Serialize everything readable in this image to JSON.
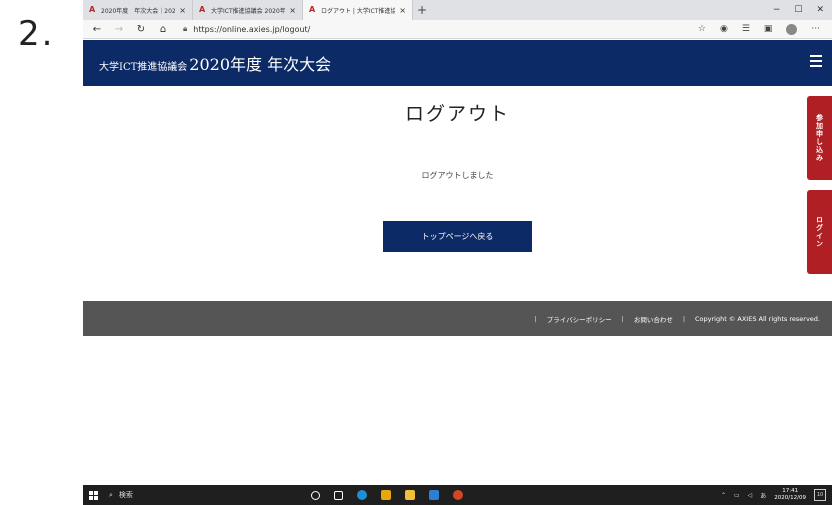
{
  "step_label": "2.",
  "browser": {
    "tabs": [
      {
        "title": "2020年度　年次大会｜2020年 ...",
        "active": false
      },
      {
        "title": "大学ICT推進協議会 2020年度 年...",
        "active": false
      },
      {
        "title": "ログアウト | 大学ICT推進協議会 20...",
        "active": true
      }
    ],
    "new_tab": "+",
    "close_glyph": "×",
    "url": "https://online.axies.jp/logout/",
    "window_controls": {
      "minimize": "−",
      "maximize": "☐",
      "close": "✕"
    },
    "more_glyph": "···"
  },
  "site": {
    "title_prefix": "大学ICT推進協議会",
    "title_main": "2020年度 年次大会",
    "page_title": "ログアウト",
    "message": "ログアウトしました",
    "top_button": "トップページへ戻る",
    "side_tabs": {
      "apply": "参加申し込み",
      "login": "ログイン"
    },
    "footer": {
      "privacy": "プライバシーポリシー",
      "contact": "お問い合わせ",
      "copyright": "Copyright © AXIES All rights reserved.",
      "separator": "|"
    }
  },
  "taskbar": {
    "search_placeholder": "検索",
    "time": "17:41",
    "date": "2020/12/09",
    "notification_count": "10"
  },
  "colors": {
    "header": "#0c2a66",
    "side_tab": "#b01f24",
    "footer": "#555555"
  }
}
